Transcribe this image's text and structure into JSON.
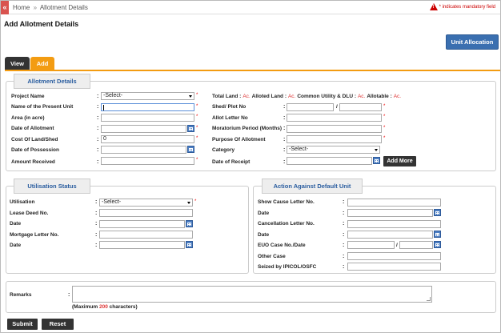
{
  "breadcrumb": {
    "home": "Home",
    "separator": "»",
    "current": "Allotment Details"
  },
  "mandatory_note": "* indicates mandatory field",
  "page_title": "Add Allotment Details",
  "allocation_button": "Unit Allocation",
  "tabs": [
    {
      "label": "View",
      "active": false
    },
    {
      "label": "Add",
      "active": true
    }
  ],
  "allotment": {
    "legend": "Allotment Details",
    "project_name": {
      "label": "Project Name",
      "value": "-Select-"
    },
    "totals": {
      "total_land": "Total Land :",
      "alloted_land": "Alloted Land :",
      "common": "Common Utility & DLU :",
      "allotable": "Allotable :",
      "unit": "Ac."
    },
    "present_unit": {
      "label": "Name of the Present Unit",
      "value": ""
    },
    "area": {
      "label": "Area (in acre)",
      "value": ""
    },
    "date_allotment": {
      "label": "Date of Allotment",
      "value": ""
    },
    "cost": {
      "label": "Cost Of Land/Shed",
      "value": "0"
    },
    "possession": {
      "label": "Date of Possession",
      "value": ""
    },
    "amount_received": {
      "label": "Amount Received",
      "value": ""
    },
    "shed_plot": {
      "label": "Shed/ Plot No",
      "separator": "/"
    },
    "allot_letter": {
      "label": "Allot Letter No",
      "value": ""
    },
    "moratorium": {
      "label": "Moratorium Period (Months)",
      "value": ""
    },
    "purpose": {
      "label": "Purpose Of Allotment",
      "value": ""
    },
    "category": {
      "label": "Category",
      "value": "-Select-"
    },
    "receipt": {
      "label": "Date of Receipt",
      "value": ""
    },
    "add_more": "Add More"
  },
  "utilisation": {
    "legend": "Utilisation Status",
    "utilisation": {
      "label": "Utilisation",
      "value": "-Select-"
    },
    "lease_deed": {
      "label": "Lease Deed No."
    },
    "date1": {
      "label": "Date"
    },
    "mortgage": {
      "label": "Mortgage Letter No."
    },
    "date2": {
      "label": "Date"
    }
  },
  "default_action": {
    "legend": "Action Against Default Unit",
    "show_cause": {
      "label": "Show Cause Letter No."
    },
    "date1": {
      "label": "Date"
    },
    "cancellation": {
      "label": "Cancellation Letter No."
    },
    "date2": {
      "label": "Date"
    },
    "euo_case": {
      "label": "EUO Case No./Date",
      "separator": "/"
    },
    "other_case": {
      "label": "Other Case"
    },
    "seized": {
      "label": "Seized by IPICOL/OSFC"
    }
  },
  "remarks": {
    "label": "Remarks",
    "colon": ":",
    "limit_prefix": "(Maximum",
    "limit_value": "200",
    "limit_suffix": "characters)"
  },
  "actions": {
    "submit": "Submit",
    "reset": "Reset"
  },
  "glyphs": {
    "colon": ":",
    "star": "*",
    "back": "«",
    "warn": "!"
  }
}
